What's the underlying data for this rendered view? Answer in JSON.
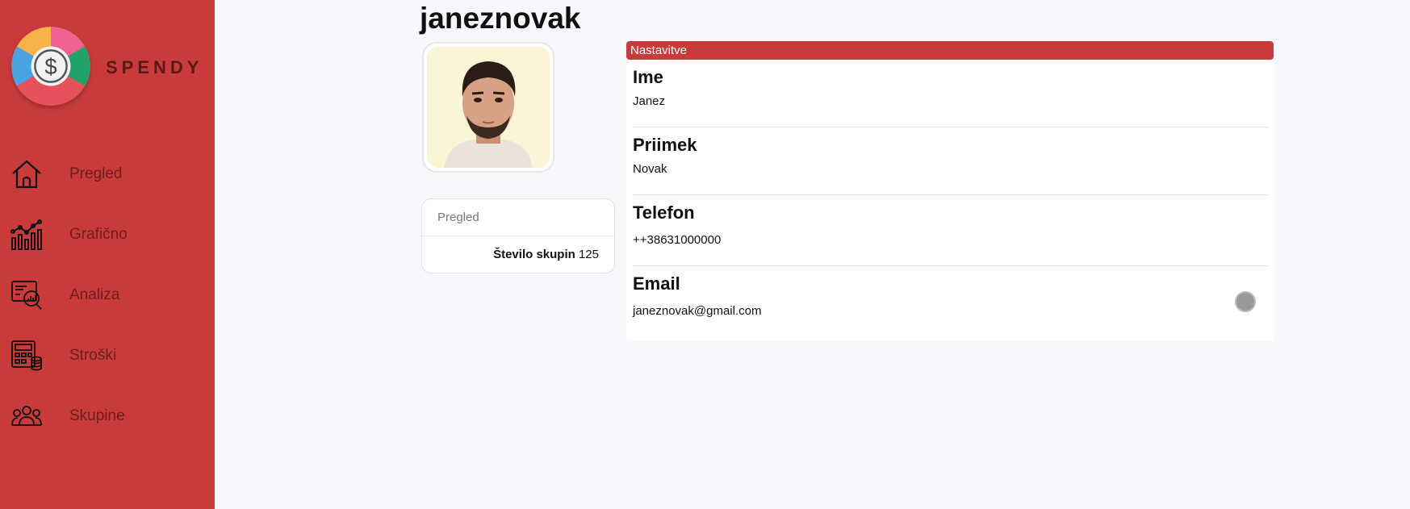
{
  "sidebar": {
    "brand": "SPENDY",
    "items": [
      {
        "label": "Pregled",
        "icon": "home-icon"
      },
      {
        "label": "Grafično",
        "icon": "chart-icon"
      },
      {
        "label": "Analiza",
        "icon": "analysis-icon"
      },
      {
        "label": "Stroški",
        "icon": "expenses-icon"
      },
      {
        "label": "Skupine",
        "icon": "groups-icon"
      }
    ]
  },
  "profile": {
    "username": "janeznovak"
  },
  "overview": {
    "title": "Pregled",
    "groups_label": "Število skupin",
    "groups_value": "125"
  },
  "settings": {
    "title": "Nastavitve",
    "fields": [
      {
        "label": "Ime",
        "value": "Janez"
      },
      {
        "label": "Priimek",
        "value": "Novak"
      },
      {
        "label": "Telefon",
        "value": "++38631000000"
      },
      {
        "label": "Email",
        "value": "janeznovak@gmail.com"
      }
    ]
  },
  "colors": {
    "accent": "#c93b3b",
    "background": "#f7f8fc"
  }
}
